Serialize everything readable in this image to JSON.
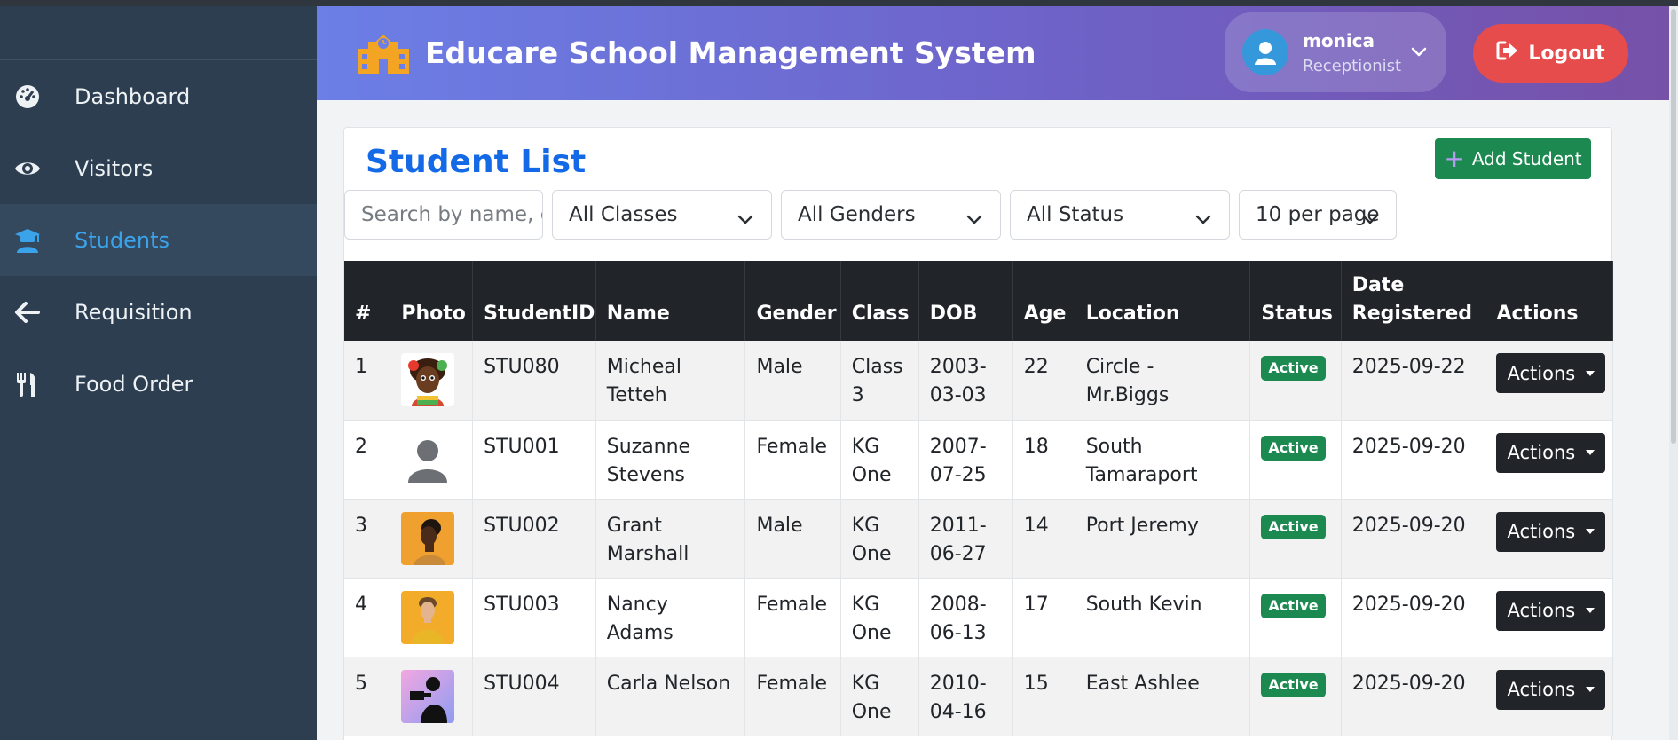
{
  "sidebar": {
    "items": [
      {
        "label": "Dashboard",
        "icon": "dashboard-gauge-icon"
      },
      {
        "label": "Visitors",
        "icon": "eye-icon"
      },
      {
        "label": "Students",
        "icon": "graduate-icon",
        "active": true
      },
      {
        "label": "Requisition",
        "icon": "arrow-left-icon"
      },
      {
        "label": "Food Order",
        "icon": "utensils-icon"
      }
    ]
  },
  "header": {
    "title": "Educare School Management System",
    "brand_icon": "school-icon",
    "user": {
      "name": "monica",
      "role": "Receptionist"
    },
    "logout_label": "Logout"
  },
  "page": {
    "title": "Student List",
    "add_label": "Add Student"
  },
  "filters": {
    "search_placeholder": "Search by name, class, or ID",
    "class_value": "All Classes",
    "gender_value": "All Genders",
    "status_value": "All Status",
    "per_page_value": "10 per page"
  },
  "table": {
    "headers": [
      "#",
      "Photo",
      "StudentID",
      "Name",
      "Gender",
      "Class",
      "DOB",
      "Age",
      "Location",
      "Status",
      "Date Registered",
      "Actions"
    ],
    "rows": [
      {
        "num": "1",
        "photo": "child-portrait",
        "id": "STU080",
        "name": "Micheal Tetteh",
        "gender": "Male",
        "class": "Class 3",
        "dob": "2003-03-03",
        "age": "22",
        "location": "Circle - Mr.Biggs",
        "status": "Active",
        "registered": "2025-09-22",
        "action": "Actions"
      },
      {
        "num": "2",
        "photo": "default-avatar",
        "id": "STU001",
        "name": "Suzanne Stevens",
        "gender": "Female",
        "class": "KG One",
        "dob": "2007-07-25",
        "age": "18",
        "location": "South Tamaraport",
        "status": "Active",
        "registered": "2025-09-20",
        "action": "Actions"
      },
      {
        "num": "3",
        "photo": "man-profile-yellow",
        "id": "STU002",
        "name": "Grant Marshall",
        "gender": "Male",
        "class": "KG One",
        "dob": "2011-06-27",
        "age": "14",
        "location": "Port Jeremy",
        "status": "Active",
        "registered": "2025-09-20",
        "action": "Actions"
      },
      {
        "num": "4",
        "photo": "man-yellow-shirt",
        "id": "STU003",
        "name": "Nancy Adams",
        "gender": "Female",
        "class": "KG One",
        "dob": "2008-06-13",
        "age": "17",
        "location": "South Kevin",
        "status": "Active",
        "registered": "2025-09-20",
        "action": "Actions"
      },
      {
        "num": "5",
        "photo": "photographer-silhouette",
        "id": "STU004",
        "name": "Carla Nelson",
        "gender": "Female",
        "class": "KG One",
        "dob": "2010-04-16",
        "age": "15",
        "location": "East Ashlee",
        "status": "Active",
        "registered": "2025-09-20",
        "action": "Actions"
      }
    ]
  },
  "colors": {
    "sidebar_bg": "#2c3e50",
    "active_item": "#3ba3ea",
    "title_blue": "#1469e6",
    "success_green": "#1c8a50",
    "logout_red": "#e74c4c",
    "table_head": "#212529"
  }
}
